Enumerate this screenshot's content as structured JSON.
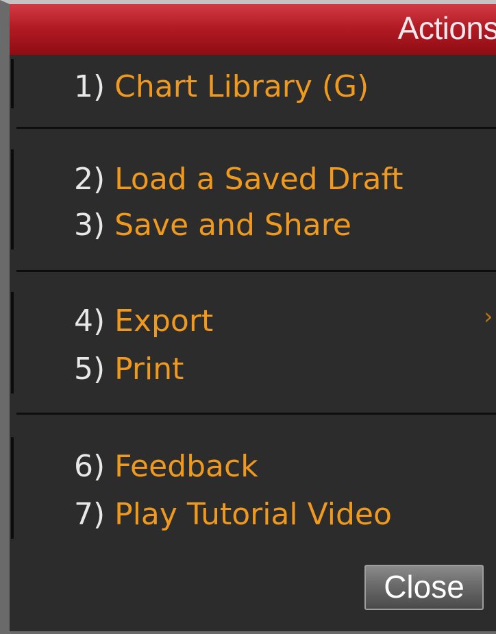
{
  "window": {
    "title": "Actions"
  },
  "menu": {
    "items": [
      {
        "num": "1)",
        "label": " Chart Library (G)"
      },
      {
        "num": "2)",
        "label": " Load a Saved Draft"
      },
      {
        "num": "3)",
        "label": " Save and Share"
      },
      {
        "num": "4)",
        "label": " Export",
        "submenu_chevron": "›"
      },
      {
        "num": "5)",
        "label": " Print"
      },
      {
        "num": "6)",
        "label": " Feedback"
      },
      {
        "num": "7)",
        "label": " Play Tutorial Video"
      }
    ]
  },
  "footer": {
    "close_label": "Close"
  },
  "colors": {
    "title_bar": "#b31b24",
    "item_label": "#ef9a1e",
    "item_number": "#e8e8e8",
    "background": "#2c2c2c"
  }
}
